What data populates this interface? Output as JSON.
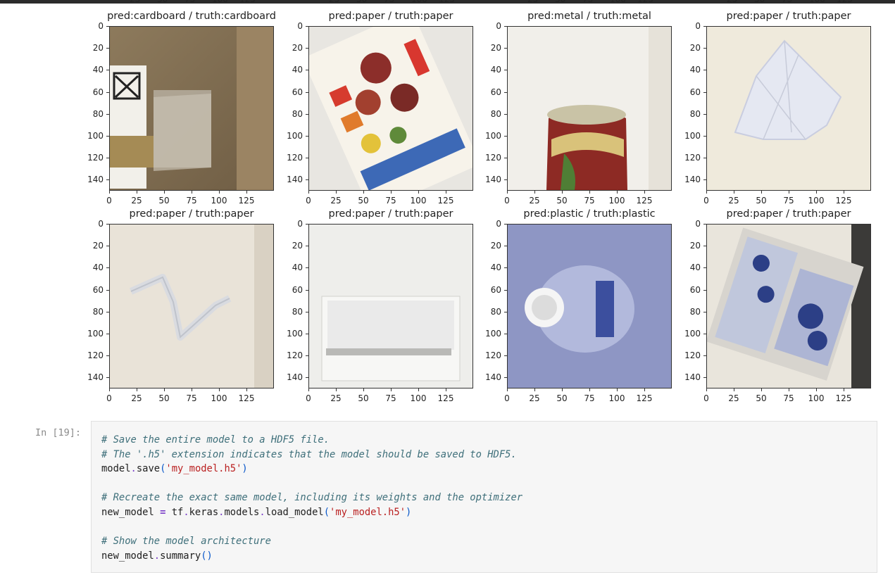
{
  "plots": {
    "cut_x_ticks": [
      "25",
      "50",
      "75",
      "100",
      "125"
    ],
    "y_ticks": [
      "0",
      "20",
      "40",
      "60",
      "80",
      "100",
      "120",
      "140"
    ],
    "x_ticks": [
      "0",
      "25",
      "50",
      "75",
      "100",
      "125"
    ],
    "panels": [
      {
        "title": "pred:cardboard / truth:cardboard",
        "image": "cardboard-photo"
      },
      {
        "title": "pred:paper / truth:paper",
        "image": "grocery-flyer-photo"
      },
      {
        "title": "pred:metal / truth:metal",
        "image": "metal-can-photo"
      },
      {
        "title": "pred:paper / truth:paper",
        "image": "crumpled-paper-photo"
      },
      {
        "title": "pred:paper / truth:paper",
        "image": "paper-strip-photo"
      },
      {
        "title": "pred:paper / truth:paper",
        "image": "white-paper-sheet-photo"
      },
      {
        "title": "pred:plastic / truth:plastic",
        "image": "plastic-bottle-photo"
      },
      {
        "title": "pred:paper / truth:paper",
        "image": "magazine-page-photo"
      }
    ]
  },
  "cell": {
    "prompt": "In [19]:",
    "lines": {
      "l1": "# Save the entire model to a HDF5 file.",
      "l2": "# The '.h5' extension indicates that the model should be saved to HDF5.",
      "l3_a": "model",
      "l3_b": ".",
      "l3_c": "save",
      "l3_d": "(",
      "l3_e": "'my_model.h5'",
      "l3_f": ")",
      "l4": "# Recreate the exact same model, including its weights and the optimizer",
      "l5_a": "new_model ",
      "l5_b": "=",
      "l5_c": " tf",
      "l5_d": ".",
      "l5_e": "keras",
      "l5_f": ".",
      "l5_g": "models",
      "l5_h": ".",
      "l5_i": "load_model",
      "l5_j": "(",
      "l5_k": "'my_model.h5'",
      "l5_l": ")",
      "l6": "# Show the model architecture",
      "l7_a": "new_model",
      "l7_b": ".",
      "l7_c": "summary",
      "l7_d": "()"
    }
  },
  "colors": {
    "comment": "#3e6f7a",
    "string": "#ba2121",
    "operator": "#7a3ec8",
    "cell_bg": "#f6f6f6"
  }
}
